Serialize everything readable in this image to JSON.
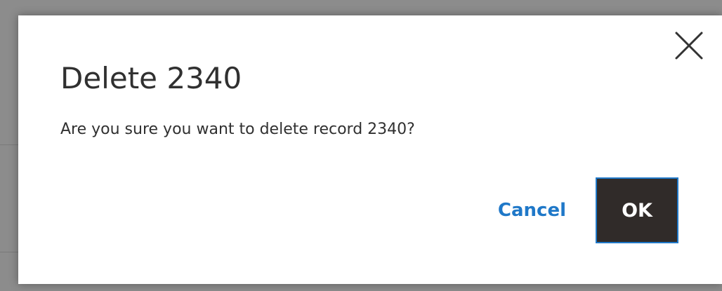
{
  "dialog": {
    "title": "Delete 2340",
    "message": "Are you sure you want to delete record 2340?",
    "close_icon": "close-icon",
    "cancel_label": "Cancel",
    "ok_label": "OK"
  },
  "colors": {
    "overlay": "#8c8c8c",
    "modal_background": "#ffffff",
    "text": "#303030",
    "accent": "#1f78c8",
    "primary_button": "#302b29"
  }
}
